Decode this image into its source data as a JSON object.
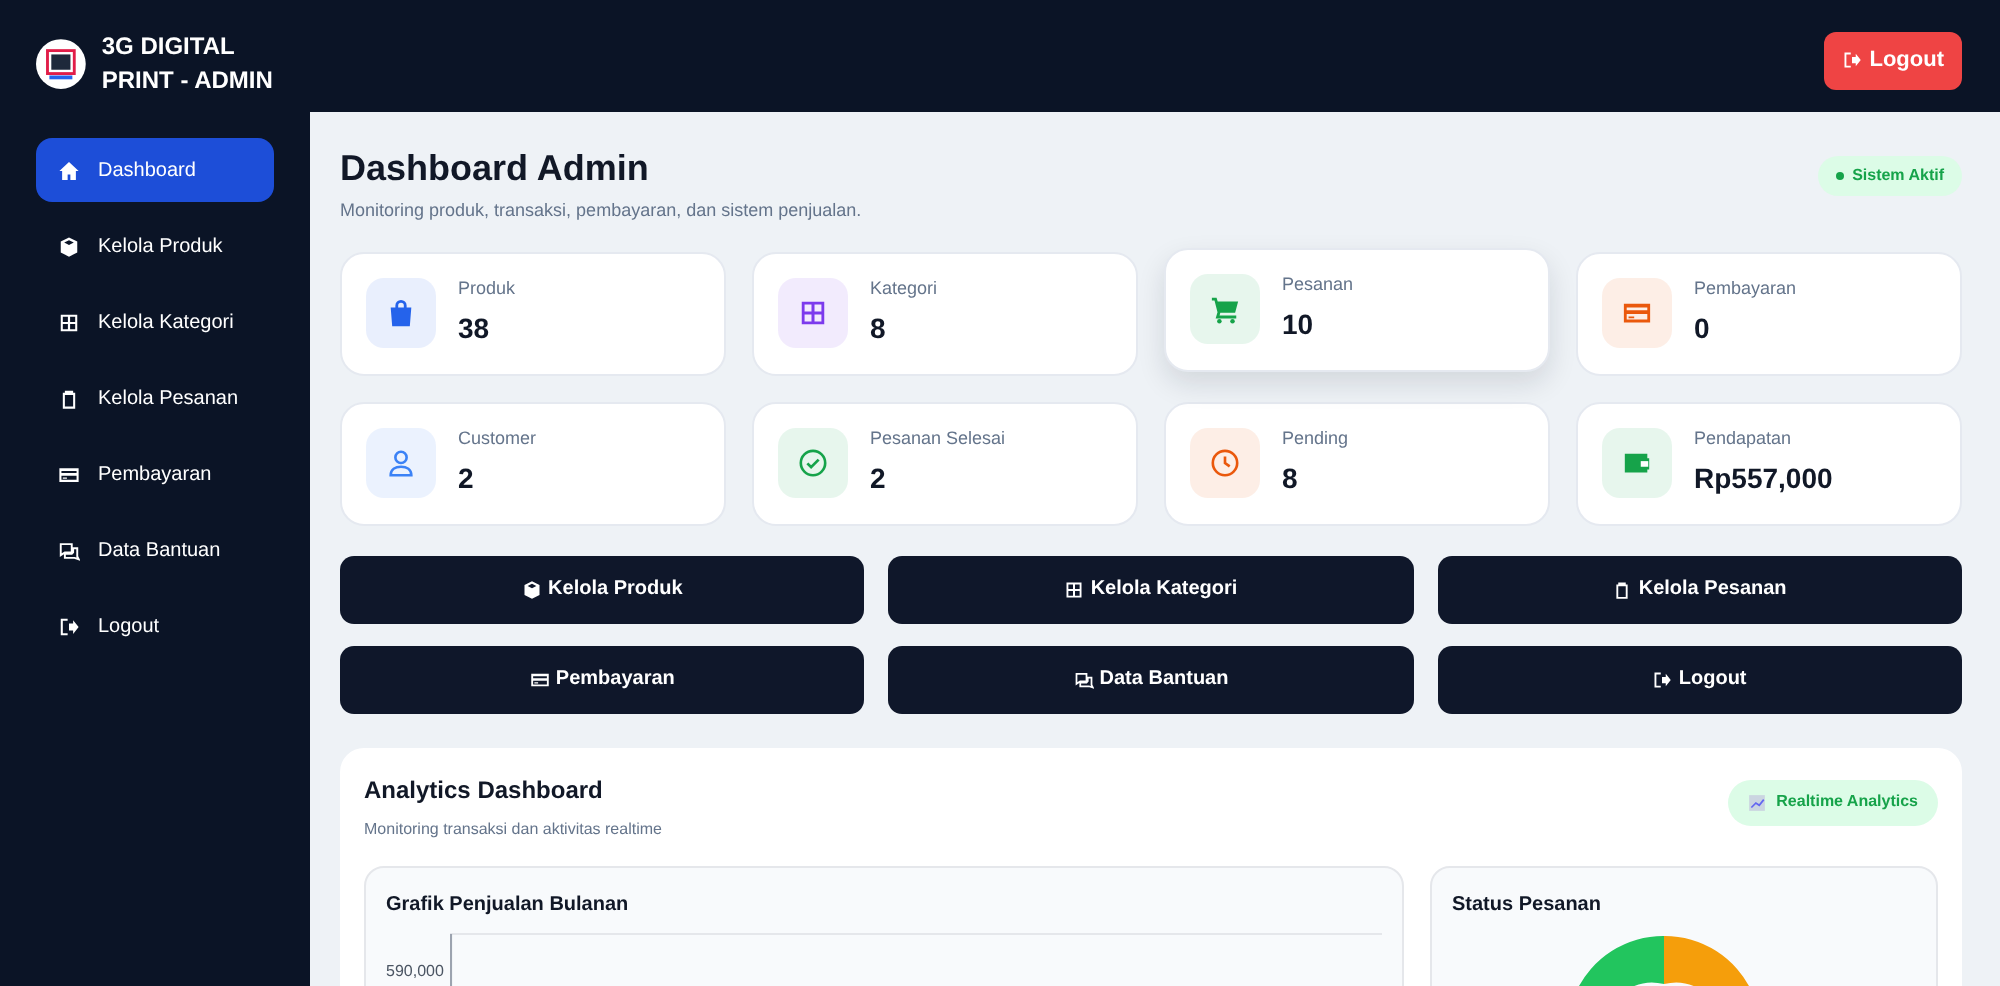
{
  "brand": {
    "title": "3G DIGITAL PRINT - ADMIN"
  },
  "sidebar": {
    "items": [
      {
        "label": "Dashboard",
        "selected": true
      },
      {
        "label": "Kelola Produk",
        "selected": false
      },
      {
        "label": "Kelola Kategori",
        "selected": false
      },
      {
        "label": "Kelola Pesanan",
        "selected": false
      },
      {
        "label": "Pembayaran",
        "selected": false
      },
      {
        "label": "Data Bantuan",
        "selected": false
      },
      {
        "label": "Logout",
        "selected": false
      }
    ]
  },
  "topbar": {
    "logout_button": "Logout"
  },
  "header": {
    "title": "Dashboard Admin",
    "subtitle": "Monitoring produk, transaksi, pembayaran, dan sistem penjualan.",
    "status_badge": "Sistem Aktif"
  },
  "stats": [
    {
      "label": "Produk",
      "value": "38",
      "color": "#2563eb",
      "hovered": false
    },
    {
      "label": "Kategori",
      "value": "8",
      "color": "#7c3aed",
      "hovered": false
    },
    {
      "label": "Pesanan",
      "value": "10",
      "color": "#16a34a",
      "hovered": true
    },
    {
      "label": "Pembayaran",
      "value": "0",
      "color": "#ea580c",
      "hovered": false
    },
    {
      "label": "Customer",
      "value": "2",
      "color": "#3b82f6",
      "hovered": false
    },
    {
      "label": "Pesanan Selesai",
      "value": "2",
      "color": "#16a34a",
      "hovered": false
    },
    {
      "label": "Pending",
      "value": "8",
      "color": "#ea580c",
      "hovered": false
    },
    {
      "label": "Pendapatan",
      "value": "Rp557,000",
      "color": "#16a34a",
      "hovered": false
    }
  ],
  "quick_actions": [
    "Kelola Produk",
    "Kelola Kategori",
    "Kelola Pesanan",
    "Pembayaran",
    "Data Bantuan",
    "Logout"
  ],
  "analytics": {
    "title": "Analytics Dashboard",
    "subtitle": "Monitoring transaksi dan aktivitas realtime",
    "badge": "Realtime Analytics",
    "sales_panel": {
      "title": "Grafik Penjualan Bulanan",
      "y_tick": "590,000"
    },
    "status_panel": {
      "title": "Status Pesanan"
    }
  }
}
